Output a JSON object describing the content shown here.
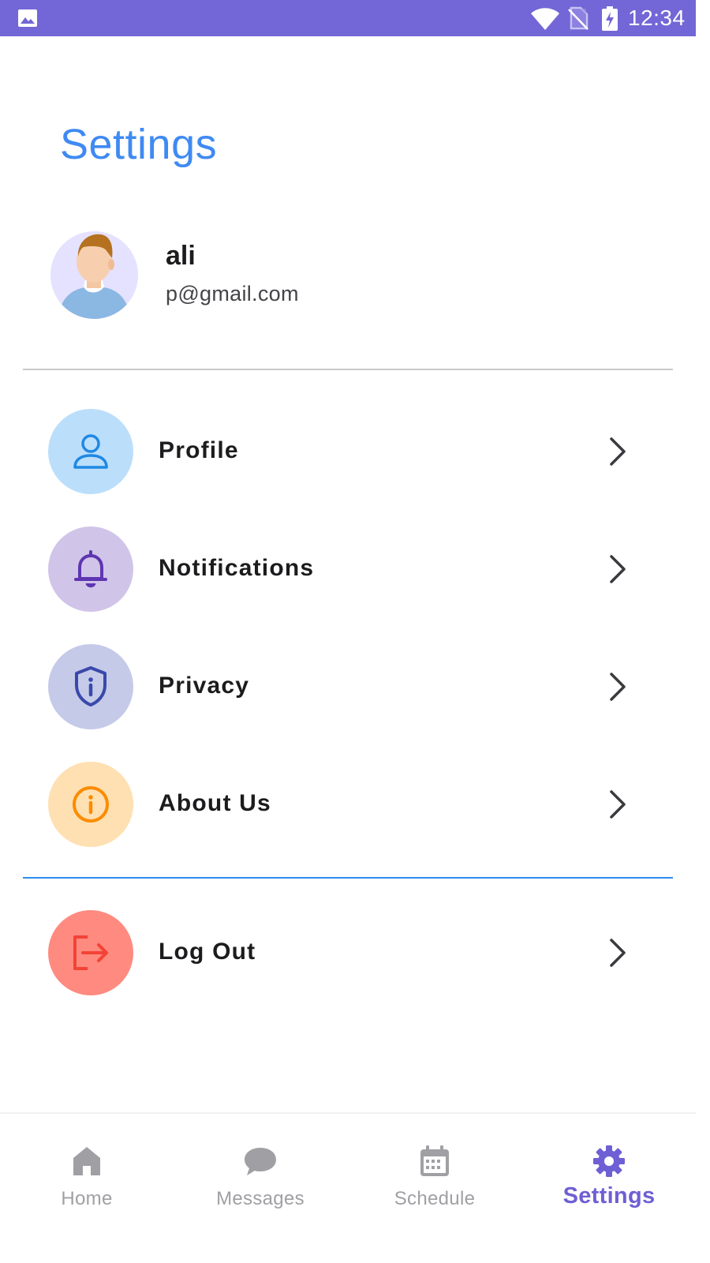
{
  "status_bar": {
    "time": "12:34",
    "icons": [
      "gallery-icon",
      "wifi-icon",
      "no-sim-icon",
      "battery-charging-icon"
    ],
    "background_color": "#7366d6"
  },
  "header": {
    "title": "Settings",
    "title_color": "#3f8af2"
  },
  "user": {
    "name": "ali",
    "email": "p@gmail.com"
  },
  "menu": [
    {
      "label": "Profile",
      "icon": "person-icon",
      "icon_color": "#1e88e5",
      "circle_color": "#bbdefb"
    },
    {
      "label": "Notifications",
      "icon": "bell-icon",
      "icon_color": "#5e35b1",
      "circle_color": "#d1c4e9"
    },
    {
      "label": "Privacy",
      "icon": "shield-icon",
      "icon_color": "#3949ab",
      "circle_color": "#c5cae9"
    },
    {
      "label": "About Us",
      "icon": "info-icon",
      "icon_color": "#fb8c00",
      "circle_color": "#ffe0b2"
    }
  ],
  "logout": {
    "label": "Log Out",
    "icon": "logout-icon",
    "icon_color": "#f44336",
    "circle_color": "#ff8a80"
  },
  "bottom_nav": {
    "items": [
      {
        "label": "Home",
        "icon": "home-icon",
        "active": false
      },
      {
        "label": "Messages",
        "icon": "chat-bubble-icon",
        "active": false
      },
      {
        "label": "Schedule",
        "icon": "calendar-icon",
        "active": false
      },
      {
        "label": "Settings",
        "icon": "gear-icon",
        "active": true
      }
    ],
    "active_color": "#6e5fd4",
    "inactive_color": "#a0a0a4"
  }
}
